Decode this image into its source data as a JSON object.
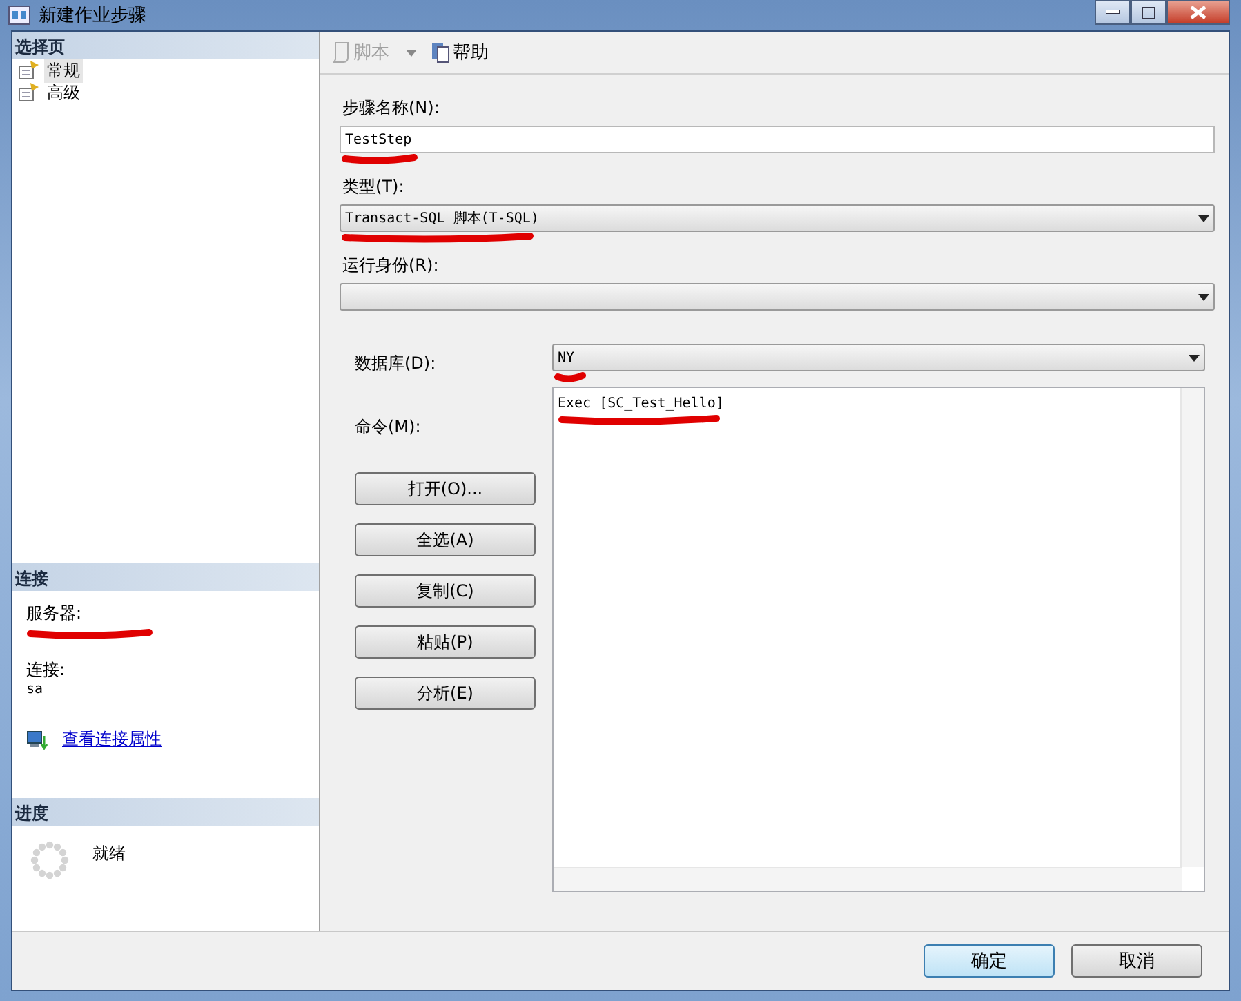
{
  "window": {
    "title": "新建作业步骤"
  },
  "sidebar": {
    "header": "选择页",
    "items": [
      {
        "label": "常规",
        "selected": true
      },
      {
        "label": "高级",
        "selected": false
      }
    ]
  },
  "connection": {
    "header": "连接",
    "server_label": "服务器:",
    "login_label": "连接:",
    "login": "sa",
    "link": "查看连接属性"
  },
  "progress": {
    "header": "进度",
    "status": "就绪"
  },
  "toolbar": [
    {
      "label": "脚本",
      "disabled": true,
      "kind": "script"
    },
    {
      "label": "帮助",
      "disabled": false,
      "kind": "help"
    }
  ],
  "form": {
    "step_name": {
      "label": "步骤名称(N):",
      "value": "TestStep"
    },
    "type": {
      "label": "类型(T):",
      "value": "Transact-SQL 脚本(T-SQL)"
    },
    "run_as": {
      "label": "运行身份(R):"
    },
    "database": {
      "label": "数据库(D):",
      "value": "NY"
    },
    "command": {
      "label": "命令(M):",
      "value": "Exec [SC_Test_Hello]"
    }
  },
  "command_buttons": [
    "打开(O)...",
    "全选(A)",
    "复制(C)",
    "粘贴(P)",
    "分析(E)"
  ],
  "buttons": [
    {
      "label": "确定",
      "default": true
    },
    {
      "label": "取消",
      "default": false
    }
  ]
}
